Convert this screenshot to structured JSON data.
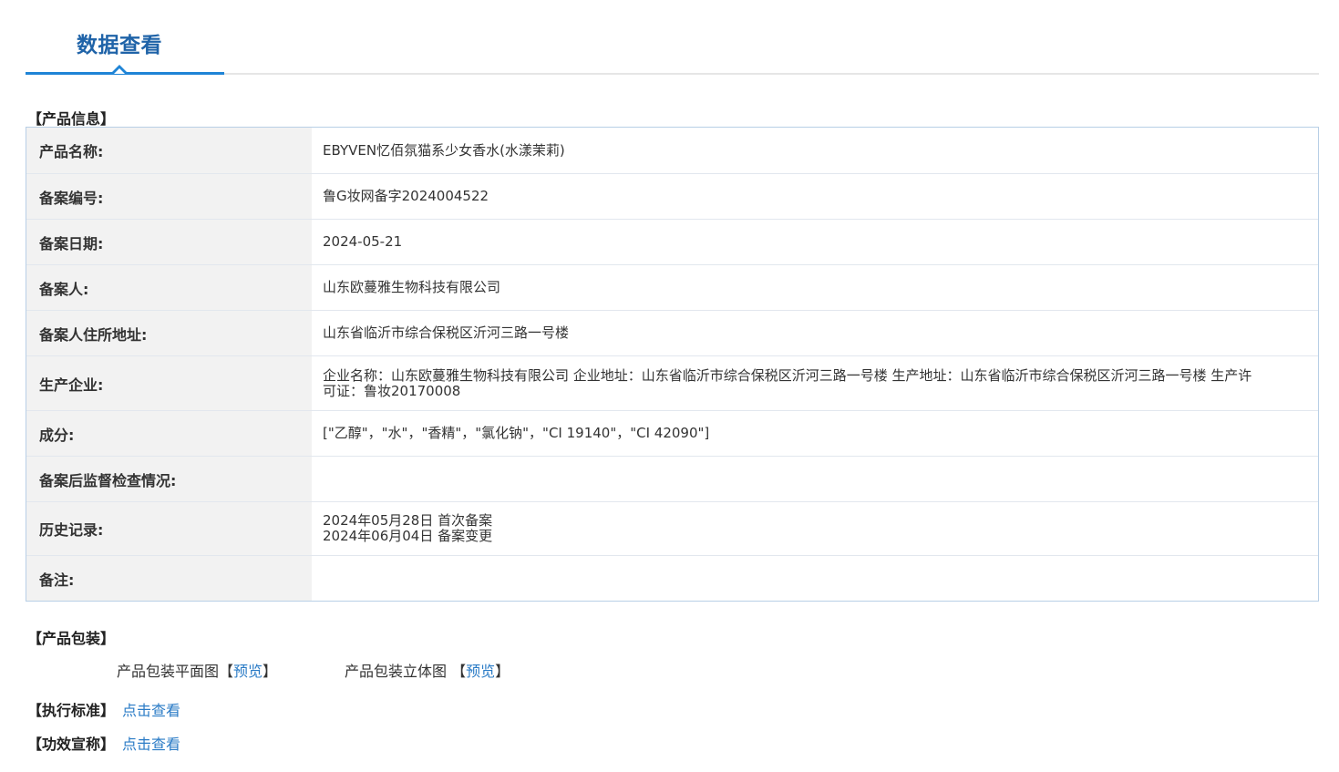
{
  "header": {
    "tab_title": "数据查看"
  },
  "product_info": {
    "section_title": "【产品信息】",
    "rows": [
      {
        "label": "产品名称:",
        "value": "EBYVEN忆佰氛猫系少女香水(水漾茉莉)"
      },
      {
        "label": "备案编号:",
        "value": "鲁G妆网备字2024004522"
      },
      {
        "label": "备案日期:",
        "value": "2024-05-21"
      },
      {
        "label": "备案人:",
        "value": "山东欧蔓雅生物科技有限公司"
      },
      {
        "label": "备案人住所地址:",
        "value": "山东省临沂市综合保税区沂河三路一号楼"
      },
      {
        "label": "生产企业:",
        "value": "企业名称：山东欧蔓雅生物科技有限公司 企业地址：山东省临沂市综合保税区沂河三路一号楼 生产地址：山东省临沂市综合保税区沂河三路一号楼 生产许可证：鲁妆20170008"
      },
      {
        "label": "成分:",
        "value": "[\"乙醇\"，\"水\"，\"香精\"，\"氯化钠\"，\"CI 19140\"，\"CI 42090\"]"
      },
      {
        "label": "备案后监督检查情况:",
        "value": ""
      },
      {
        "label": "历史记录:",
        "value": "2024年05月28日 首次备案\n2024年06月04日 备案变更"
      },
      {
        "label": "备注:",
        "value": ""
      }
    ]
  },
  "packaging": {
    "section_title": "【产品包装】",
    "flat_label": "产品包装平面图",
    "flat_open": "【",
    "flat_link": "预览",
    "flat_close": "】",
    "stereo_label": "产品包装立体图 ",
    "stereo_open": "【",
    "stereo_link": "预览",
    "stereo_close": "】"
  },
  "standard": {
    "label": "【执行标准】",
    "link": "点击查看"
  },
  "efficacy": {
    "label": "【功效宣称】",
    "link": "点击查看"
  }
}
